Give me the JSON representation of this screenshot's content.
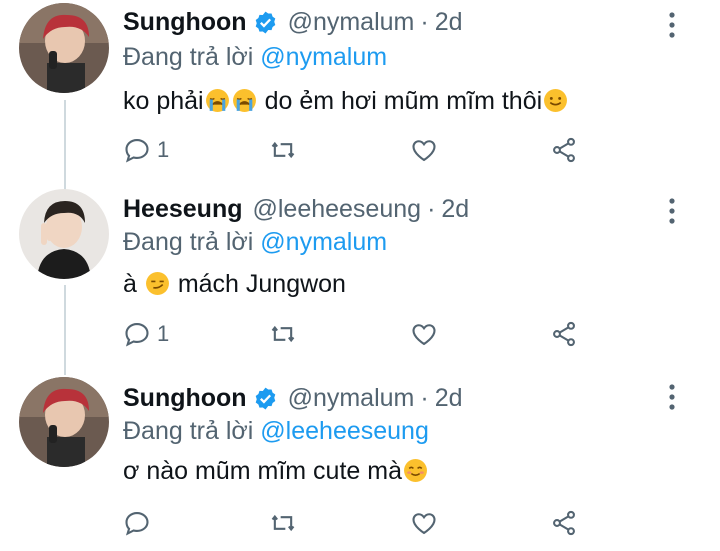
{
  "tweets": [
    {
      "name": "Sunghoon",
      "verified": true,
      "handle": "@nymalum",
      "dot": "·",
      "time": "2d",
      "reply_prefix": "Đang trả lời",
      "reply_to": "@nymalum",
      "text_parts": [
        "ko phải",
        "do ẻm hơi mũm mĩm thôi"
      ],
      "emojis": [
        "crying-face",
        "crying-face",
        "smiling-face"
      ],
      "reply_count": "1",
      "avatar_colors": {
        "bg": "#6b5a50",
        "hair": "#b8323a",
        "skin": "#e8c7b0",
        "shirt": "#2b2b2b"
      }
    },
    {
      "name": "Heeseung",
      "verified": false,
      "handle": "@leeheeseung",
      "dot": "·",
      "time": "2d",
      "reply_prefix": "Đang trả lời",
      "reply_to": "@nymalum",
      "text_parts": [
        "à",
        "mách Jungwon"
      ],
      "emojis": [
        "smirking-face"
      ],
      "reply_count": "1",
      "avatar_colors": {
        "bg": "#e9e6e3",
        "hair": "#2a2420",
        "skin": "#f0d6c3",
        "shirt": "#1c1c1c"
      }
    },
    {
      "name": "Sunghoon",
      "verified": true,
      "handle": "@nymalum",
      "dot": "·",
      "time": "2d",
      "reply_prefix": "Đang trả lời",
      "reply_to": "@leeheeseung",
      "text_parts": [
        "ơ nào mũm mĩm cute mà"
      ],
      "emojis": [
        "smiling-face-blush"
      ],
      "reply_count": "",
      "avatar_colors": {
        "bg": "#6b5a50",
        "hair": "#b8323a",
        "skin": "#e8c7b0",
        "shirt": "#2b2b2b"
      }
    }
  ],
  "colors": {
    "accent": "#1d9bf0",
    "secondary_text": "#536471",
    "thread_line": "#cfd9de",
    "emoji_yellow": "#fbc02d",
    "tear_blue": "#4aa3df"
  },
  "icons": [
    "reply-icon",
    "retweet-icon",
    "like-icon",
    "share-icon",
    "more-icon",
    "verified-badge-icon"
  ]
}
